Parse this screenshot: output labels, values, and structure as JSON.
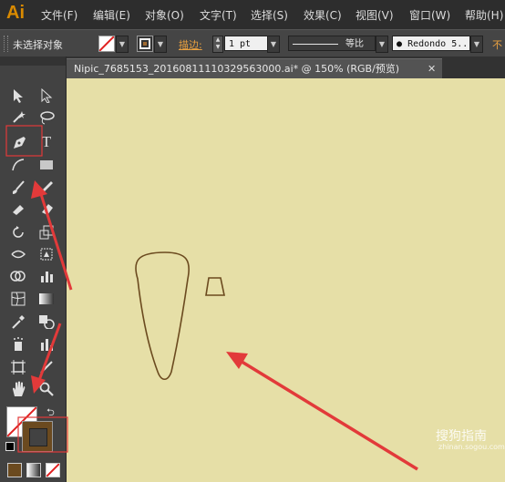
{
  "app": {
    "logo": "Ai"
  },
  "menu": {
    "items": [
      "文件(F)",
      "编辑(E)",
      "对象(O)",
      "文字(T)",
      "选择(S)",
      "效果(C)",
      "视图(V)",
      "窗口(W)",
      "帮助(H)"
    ]
  },
  "control_bar": {
    "selection_status": "未选择对象",
    "stroke_label": "描边:",
    "stroke_weight": "1 pt",
    "profile_label": "等比",
    "brush_name": "Redondo 5..",
    "opacity_label": "不"
  },
  "document": {
    "tab_title": "Nipic_7685153_20160811110329563000.ai* @ 150% (RGB/预览)",
    "close_glyph": "✕"
  },
  "canvas": {
    "background": "#e6dfa7",
    "stroke_color": "#6b4a1f"
  },
  "tools": {
    "type_glyph": "T"
  },
  "annotations": {
    "color": "#e23a3a"
  },
  "watermark": {
    "brand": "搜狗指南",
    "domain": "zhinan.sogou.com"
  }
}
